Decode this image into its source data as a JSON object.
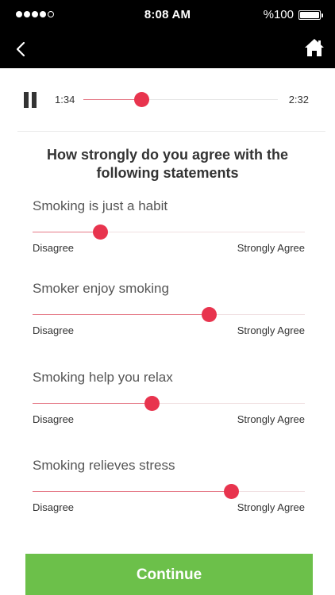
{
  "status_bar": {
    "time": "8:08 AM",
    "battery_text": "%100",
    "signal_bars_filled": 4,
    "signal_bars_total": 5
  },
  "nav": {
    "back_icon": "chevron-left-icon",
    "home_icon": "home-icon"
  },
  "player": {
    "current_time": "1:34",
    "total_time": "2:32",
    "progress_fraction": 0.3
  },
  "question": "How strongly do you agree with the following statements",
  "statements": [
    {
      "label": "Smoking is just a habit",
      "value": 0.25,
      "min_label": "Disagree",
      "max_label": "Strongly Agree"
    },
    {
      "label": "Smoker enjoy smoking",
      "value": 0.65,
      "min_label": "Disagree",
      "max_label": "Strongly Agree"
    },
    {
      "label": "Smoking help you relax",
      "value": 0.44,
      "min_label": "Disagree",
      "max_label": "Strongly Agree"
    },
    {
      "label": "Smoking relieves stress",
      "value": 0.73,
      "min_label": "Disagree",
      "max_label": "Strongly Agree"
    }
  ],
  "continue_label": "Continue",
  "colors": {
    "accent": "#e8344e",
    "track_fill": "#e57a87",
    "button": "#6cc04a",
    "header": "#000000"
  }
}
